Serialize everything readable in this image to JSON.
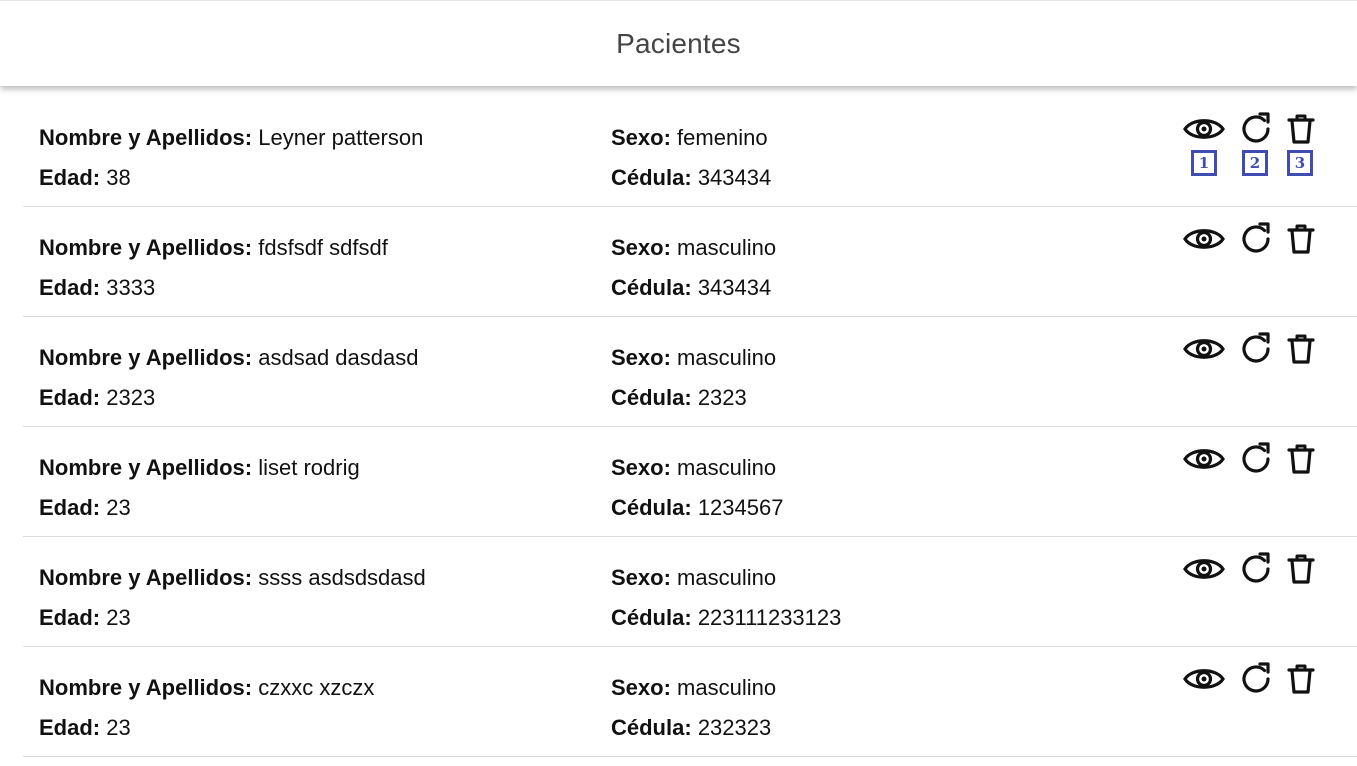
{
  "header": {
    "title": "Pacientes"
  },
  "labels": {
    "name": "Nombre y Apellidos:",
    "age": "Edad:",
    "sex": "Sexo:",
    "id": "Cédula:"
  },
  "actions": {
    "view_icon": "eye-icon",
    "refresh_icon": "refresh-icon",
    "delete_icon": "trash-icon"
  },
  "badges": [
    "1",
    "2",
    "3"
  ],
  "patients": [
    {
      "name": "Leyner patterson",
      "age": "38",
      "sex": "femenino",
      "id": "343434"
    },
    {
      "name": "fdsfsdf sdfsdf",
      "age": "3333",
      "sex": "masculino",
      "id": "343434"
    },
    {
      "name": "asdsad dasdasd",
      "age": "2323",
      "sex": "masculino",
      "id": "2323"
    },
    {
      "name": "liset rodrig",
      "age": "23",
      "sex": "masculino",
      "id": "1234567"
    },
    {
      "name": "ssss asdsdsdasd",
      "age": "23",
      "sex": "masculino",
      "id": "223111233123"
    },
    {
      "name": "czxxc xzczx",
      "age": "23",
      "sex": "masculino",
      "id": "232323"
    }
  ],
  "colors": {
    "badge": "#3f4db3",
    "divider": "#dcdcdc",
    "title": "#444444"
  }
}
